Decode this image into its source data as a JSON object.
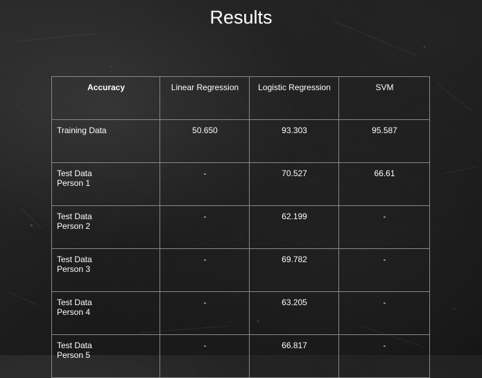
{
  "title": "Results",
  "table": {
    "headers": [
      "Accuracy",
      "Linear Regression",
      "Logistic Regression",
      "SVM"
    ],
    "rows": [
      {
        "label_lines": [
          "Training Data"
        ],
        "linear": "50.650",
        "logistic": "93.303",
        "svm": "95.587"
      },
      {
        "label_lines": [
          "Test Data",
          "Person 1"
        ],
        "linear": "-",
        "logistic": "70.527",
        "svm": "66.61"
      },
      {
        "label_lines": [
          "Test Data",
          "Person 2"
        ],
        "linear": "-",
        "logistic": "62.199",
        "svm": "-"
      },
      {
        "label_lines": [
          "Test Data",
          "Person 3"
        ],
        "linear": "-",
        "logistic": "69.782",
        "svm": "-"
      },
      {
        "label_lines": [
          "Test Data",
          "Person 4"
        ],
        "linear": "-",
        "logistic": "63.205",
        "svm": "-"
      },
      {
        "label_lines": [
          "Test Data",
          "Person 5"
        ],
        "linear": "-",
        "logistic": "66.817",
        "svm": "-"
      }
    ]
  },
  "colors": {
    "background": "#1b1b1b",
    "text": "#ffffff",
    "grid": "#8a8a8a"
  }
}
